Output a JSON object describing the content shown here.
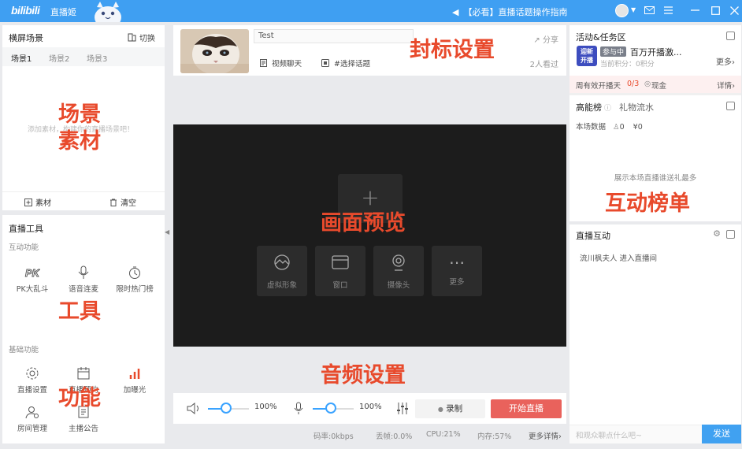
{
  "titlebar": {
    "logo": "bilibili",
    "app_name": "直播姬",
    "notice": "【必看】直播话题操作指南",
    "icons": [
      "speaker-icon",
      "avatar",
      "mail-icon",
      "menu-icon",
      "minimize-icon",
      "maximize-icon",
      "close-icon"
    ]
  },
  "left": {
    "title": "横屏场景",
    "switch_label": "切换",
    "scene_tabs": [
      "场景1",
      "场景2",
      "场景3"
    ],
    "scene_hint": "添加素材，构建你的直播场景吧！",
    "add_material": "素材",
    "clear": "清空",
    "tools_title": "直播工具",
    "interactive_title": "互动功能",
    "interactive_tools": [
      "PK大乱斗",
      "语音连麦",
      "限时热门榜"
    ],
    "basic_title": "基础功能",
    "basic_tools": [
      "直播设置",
      "直播预约",
      "加曝光",
      "房间管理",
      "主播公告"
    ]
  },
  "topcard": {
    "title_value": "Test",
    "category": "视频聊天",
    "topic": "#选择话题",
    "share": "分享",
    "watching": "2人看过"
  },
  "preview": {
    "plus": "+",
    "sources": [
      "虚拟形象",
      "窗口",
      "摄像头",
      "更多"
    ]
  },
  "audio": {
    "speaker_volume": "100%",
    "mic_volume": "100%",
    "speaker_level": 0.45,
    "mic_level": 0.45,
    "record": "录制",
    "golive": "开始直播"
  },
  "status": {
    "bitrate": "码率:0kbps",
    "drop": "丢帧:0.0%",
    "cpu": "CPU:21%",
    "memory": "内存:57%",
    "more": "更多详情"
  },
  "right": {
    "activity_title": "活动&任务区",
    "badge_line1": "迎新",
    "badge_line2": "开播",
    "tag": "参与中",
    "activity_name": "百万开播激...",
    "points": "当前积分：0积分",
    "more": "更多",
    "week_label": "周有效开播天",
    "week_value": "0/3",
    "week_reward": "现金",
    "details": "详情",
    "rank_tab_active": "高能榜",
    "rank_tab_other": "礼物流水",
    "rank_stat_label": "本场数据",
    "rank_people": "0",
    "rank_money": "¥0",
    "rank_empty": "展示本场直播谁送礼最多",
    "interact_title": "直播互动",
    "enter_msg": "流川枫夫人 进入直播间",
    "chat_placeholder": "和观众聊点什么吧~",
    "send": "发送"
  },
  "annotations": {
    "cover": "封标设置",
    "scene": "场景",
    "material": "素材",
    "preview": "画面预览",
    "rank": "互动榜单",
    "tools": "工具",
    "audio": "音频设置",
    "function": "功能"
  },
  "colors": {
    "titlebar": "#3f9ff2",
    "golive": "#e9625c",
    "accent": "#3aa3ff",
    "annotation": "#e84a2c"
  }
}
